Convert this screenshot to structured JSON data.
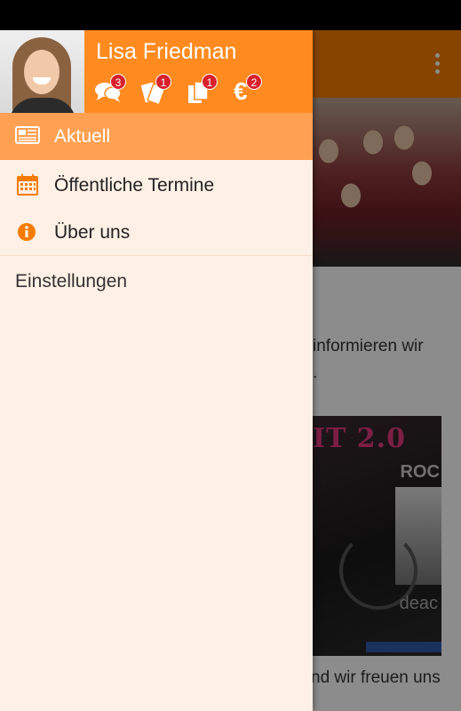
{
  "background_app": {
    "text_line_1": "informieren wir",
    "text_line_2": ".",
    "text_line_3": "nd wir freuen uns",
    "poster": {
      "title": "IT 2.0",
      "sub1": "ROC",
      "sub2": "deac"
    }
  },
  "drawer": {
    "user_name": "Lisa Friedman",
    "header_icons": [
      {
        "icon": "chat-icon",
        "badge": "3"
      },
      {
        "icon": "tickets-icon",
        "badge": "1"
      },
      {
        "icon": "documents-icon",
        "badge": "1"
      },
      {
        "icon": "euro-icon",
        "glyph": "€",
        "badge": "2"
      }
    ],
    "nav_items": [
      {
        "icon": "newspaper-icon",
        "label": "Aktuell",
        "active": true
      },
      {
        "icon": "calendar-icon",
        "label": "Öffentliche Termine",
        "active": false
      },
      {
        "icon": "info-icon",
        "label": "Über uns",
        "active": false
      }
    ],
    "settings_label": "Einstellungen"
  },
  "colors": {
    "accent": "#ff8a1f",
    "active_item": "#ffa052",
    "drawer_bg": "#fff0e5",
    "badge": "#d8212b",
    "icon_orange": "#f57c00"
  }
}
